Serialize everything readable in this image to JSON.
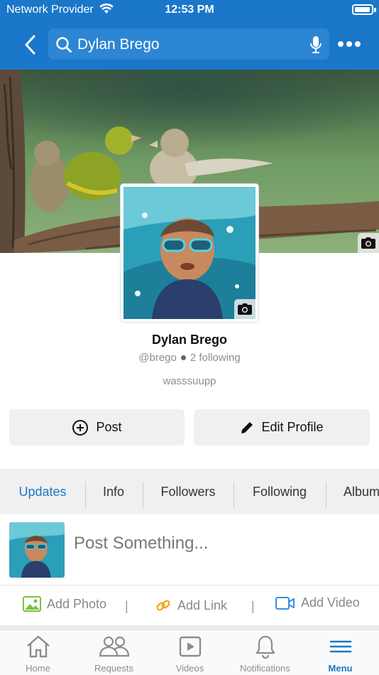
{
  "status_bar": {
    "carrier": "Network Provider",
    "time": "12:53 PM"
  },
  "header": {
    "search_text": "Dylan Brego",
    "icons": [
      "back-arrow-icon",
      "search-icon",
      "microphone-icon",
      "more-icon"
    ]
  },
  "profile": {
    "name": "Dylan Brego",
    "handle": "@brego",
    "following": "2 following",
    "bio": "wasssuupp"
  },
  "actions": {
    "post_label": "Post",
    "edit_label": "Edit Profile"
  },
  "tabs": [
    {
      "label": "Updates",
      "active": true
    },
    {
      "label": "Info"
    },
    {
      "label": "Followers"
    },
    {
      "label": "Following"
    },
    {
      "label": "Albums"
    }
  ],
  "composer": {
    "placeholder": "Post Something..."
  },
  "media": {
    "photo": "Add Photo",
    "link": "Add Link",
    "video": "Add Video",
    "separator": "|"
  },
  "bottom_nav": [
    {
      "label": "Home",
      "icon": "home-icon"
    },
    {
      "label": "Requests",
      "icon": "people-icon"
    },
    {
      "label": "Videos",
      "icon": "play-icon"
    },
    {
      "label": "Notifications",
      "icon": "bell-icon"
    },
    {
      "label": "Menu",
      "icon": "menu-icon",
      "active": true
    }
  ],
  "colors": {
    "brand": "#1a77c9",
    "photo_icon": "#7cc142",
    "link_icon": "#f0a30a",
    "video_icon": "#3b8de0"
  }
}
